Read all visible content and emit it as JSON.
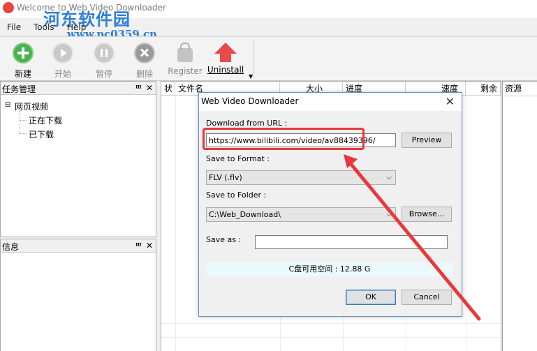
{
  "window": {
    "title": "Welcome to Web Video Downloader",
    "watermark": "河东软件园",
    "watermark_url": "www.pc0359.cn"
  },
  "menu": [
    "File",
    "Tools",
    "Help"
  ],
  "toolbar": {
    "new_label": "新建",
    "start_label": "开始",
    "pause_label": "暂停",
    "delete_label": "删除",
    "register_label": "Register",
    "uninstall_label": "Uninstall",
    "icons": {
      "new": "add-icon",
      "start": "play-icon",
      "pause": "pause-icon",
      "delete": "delete-icon",
      "register": "lock-icon",
      "uninstall": "up-arrow-icon"
    }
  },
  "task_panel": {
    "title": "任务管理",
    "pin": "Ⱎ",
    "close": "✕",
    "tree": {
      "root": "网页视频",
      "children": [
        "正在下载",
        "已下载"
      ]
    }
  },
  "info_panel": {
    "title": "信息",
    "pin": "Ⱎ",
    "close": "✕"
  },
  "list": {
    "columns": [
      "状",
      "文件名",
      "大小",
      "进度",
      "速度",
      "剩余"
    ]
  },
  "resource_panel": {
    "title": "资源"
  },
  "dialog": {
    "title": "Web Video Downloader",
    "url_label": "Download from URL :",
    "url_value": "https://www.bilibili.com/video/av88439396/",
    "preview_button": "Preview",
    "format_label": "Save to Format :",
    "format_value": "FLV (.flv)",
    "folder_label": "Save to Folder :",
    "folder_value": "C:\\Web_Download\\",
    "browse_button": "Browse...",
    "save_as_label": "Save as :",
    "save_as_value": "",
    "disk_space": "C盘可用空间 : 12.88 G",
    "ok_button": "OK",
    "cancel_button": "Cancel"
  },
  "colors": {
    "highlight": "#e8383b",
    "watermark": "#2e7fd6",
    "info_bar": "#eafafc"
  }
}
